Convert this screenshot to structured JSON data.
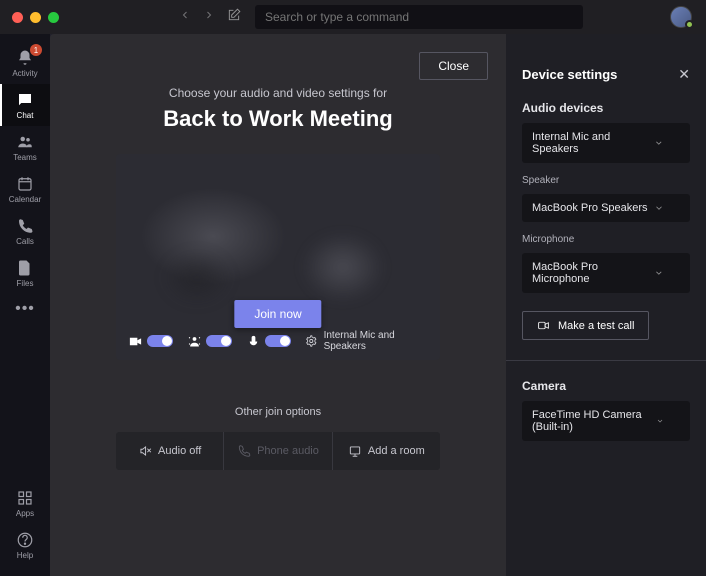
{
  "titlebar": {
    "search_placeholder": "Search or type a command"
  },
  "rail": {
    "items": [
      {
        "label": "Activity",
        "badge": "1"
      },
      {
        "label": "Chat"
      },
      {
        "label": "Teams"
      },
      {
        "label": "Calendar"
      },
      {
        "label": "Calls"
      },
      {
        "label": "Files"
      }
    ],
    "bottom": [
      {
        "label": "Apps"
      },
      {
        "label": "Help"
      }
    ]
  },
  "meeting": {
    "close": "Close",
    "choose": "Choose your audio and video settings for",
    "title": "Back to Work Meeting",
    "join": "Join now",
    "selected_device": "Internal Mic and Speakers",
    "other_options": "Other join options",
    "options": {
      "audio_off": "Audio off",
      "phone_audio": "Phone audio",
      "add_room": "Add a room"
    }
  },
  "settings": {
    "title": "Device settings",
    "audio_devices_label": "Audio devices",
    "audio_device_value": "Internal Mic and Speakers",
    "speaker_label": "Speaker",
    "speaker_value": "MacBook Pro Speakers",
    "microphone_label": "Microphone",
    "microphone_value": "MacBook Pro Microphone",
    "test_call": "Make a test call",
    "camera_label": "Camera",
    "camera_value": "FaceTime HD Camera (Built-in)"
  }
}
